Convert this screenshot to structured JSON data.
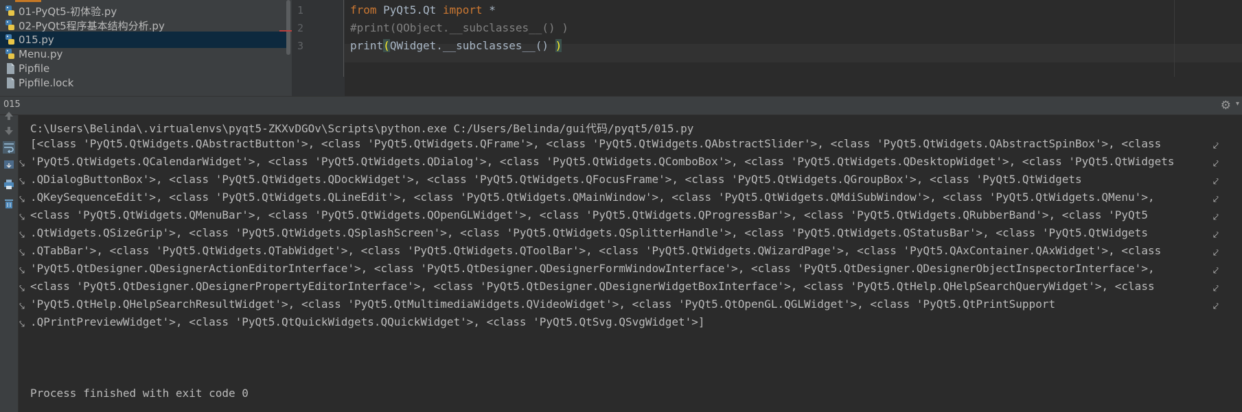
{
  "project_tree": {
    "items": [
      {
        "label": "01-PyQt5-初体验.py",
        "type": "python"
      },
      {
        "label": "02-PyQt5程序基本结构分析.py",
        "type": "python"
      },
      {
        "label": "015.py",
        "type": "python",
        "selected": true
      },
      {
        "label": "Menu.py",
        "type": "python"
      },
      {
        "label": "Pipfile",
        "type": "file"
      },
      {
        "label": "Pipfile.lock",
        "type": "file"
      }
    ]
  },
  "editor": {
    "line_numbers": [
      "1",
      "2",
      "3"
    ],
    "lines": [
      {
        "kw1": "from",
        "mid": " PyQt5.Qt ",
        "kw2": "import",
        "end": " *"
      },
      {
        "comment": "#print(QObject.__subclasses__() )"
      },
      {
        "pre": "print",
        "open": "(",
        "mid": "QWidget.__subclasses__() ",
        "close": ")"
      }
    ]
  },
  "run_panel": {
    "title": "015",
    "settings_icon": "gear-icon",
    "console": {
      "command": "C:\\Users\\Belinda\\.virtualenvs\\pyqt5-ZKXvDGOv\\Scripts\\python.exe C:/Users/Belinda/gui代码/pyqt5/015.py",
      "output_lines": [
        "[<class 'PyQt5.QtWidgets.QAbstractButton'>, <class 'PyQt5.QtWidgets.QFrame'>, <class 'PyQt5.QtWidgets.QAbstractSlider'>, <class 'PyQt5.QtWidgets.QAbstractSpinBox'>, <class ",
        "'PyQt5.QtWidgets.QCalendarWidget'>, <class 'PyQt5.QtWidgets.QDialog'>, <class 'PyQt5.QtWidgets.QComboBox'>, <class 'PyQt5.QtWidgets.QDesktopWidget'>, <class 'PyQt5.QtWidgets",
        ".QDialogButtonBox'>, <class 'PyQt5.QtWidgets.QDockWidget'>, <class 'PyQt5.QtWidgets.QFocusFrame'>, <class 'PyQt5.QtWidgets.QGroupBox'>, <class 'PyQt5.QtWidgets",
        ".QKeySequenceEdit'>, <class 'PyQt5.QtWidgets.QLineEdit'>, <class 'PyQt5.QtWidgets.QMainWindow'>, <class 'PyQt5.QtWidgets.QMdiSubWindow'>, <class 'PyQt5.QtWidgets.QMenu'>, ",
        "<class 'PyQt5.QtWidgets.QMenuBar'>, <class 'PyQt5.QtWidgets.QOpenGLWidget'>, <class 'PyQt5.QtWidgets.QProgressBar'>, <class 'PyQt5.QtWidgets.QRubberBand'>, <class 'PyQt5",
        ".QtWidgets.QSizeGrip'>, <class 'PyQt5.QtWidgets.QSplashScreen'>, <class 'PyQt5.QtWidgets.QSplitterHandle'>, <class 'PyQt5.QtWidgets.QStatusBar'>, <class 'PyQt5.QtWidgets",
        ".QTabBar'>, <class 'PyQt5.QtWidgets.QTabWidget'>, <class 'PyQt5.QtWidgets.QToolBar'>, <class 'PyQt5.QtWidgets.QWizardPage'>, <class 'PyQt5.QAxContainer.QAxWidget'>, <class ",
        "'PyQt5.QtDesigner.QDesignerActionEditorInterface'>, <class 'PyQt5.QtDesigner.QDesignerFormWindowInterface'>, <class 'PyQt5.QtDesigner.QDesignerObjectInspectorInterface'>, ",
        "<class 'PyQt5.QtDesigner.QDesignerPropertyEditorInterface'>, <class 'PyQt5.QtDesigner.QDesignerWidgetBoxInterface'>, <class 'PyQt5.QtHelp.QHelpSearchQueryWidget'>, <class ",
        "'PyQt5.QtHelp.QHelpSearchResultWidget'>, <class 'PyQt5.QtMultimediaWidgets.QVideoWidget'>, <class 'PyQt5.QtOpenGL.QGLWidget'>, <class 'PyQt5.QtPrintSupport",
        ".QPrintPreviewWidget'>, <class 'PyQt5.QtQuickWidgets.QQuickWidget'>, <class 'PyQt5.QtSvg.QSvgWidget'>]"
      ],
      "exit_message": "Process finished with exit code 0"
    }
  },
  "colors": {
    "background": "#2b2b2b",
    "keyword": "#cc7832",
    "comment": "#808080",
    "text": "#a9b7c6",
    "selection": "#0d293e"
  }
}
